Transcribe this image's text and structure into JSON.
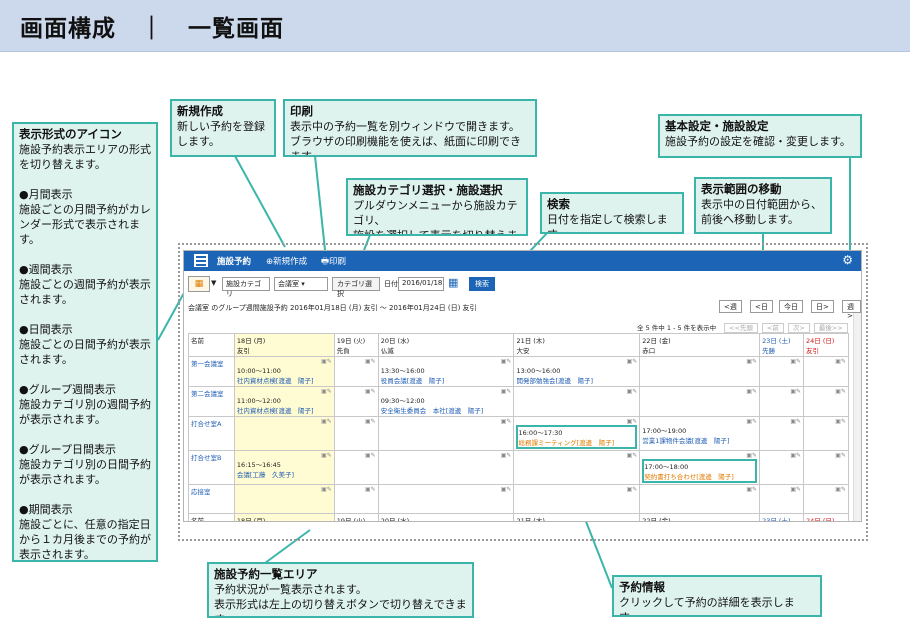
{
  "header": {
    "title": "画面構成　｜　一覧画面"
  },
  "callouts": {
    "view_icons": {
      "title": "表示形式のアイコン",
      "body": "施設予約表示エリアの形式\nを切り替えます。\n\n●月間表示\n施設ごとの月間予約がカレ\nンダー形式で表示されます。\n\n●週間表示\n施設ごとの週間予約が表示\nされます。\n\n●日間表示\n施設ごとの日間予約が表示\nされます。\n\n●グループ週間表示\n施設カテゴリ別の週間予約\nが表示されます。\n\n●グループ日間表示\n施設カテゴリ別の日間予約\nが表示されます。\n\n●期間表示\n施設ごとに、任意の指定日\nから１カ月後までの予約が\n表示されます。"
    },
    "new": {
      "title": "新規作成",
      "body": "新しい予約を登録\nします。"
    },
    "print": {
      "title": "印刷",
      "body": "表示中の予約一覧を別ウィンドウで開きます。\nブラウザの印刷機能を使えば、紙面に印刷できます。"
    },
    "settings": {
      "title": "基本設定・施設設定",
      "body": "施設予約の設定を確認・変更します。"
    },
    "category": {
      "title": "施設カテゴリ選択・施設選択",
      "body": "プルダウンメニューから施設カテゴリ、\n施設を選択して表示を切り替えます。"
    },
    "search": {
      "title": "検索",
      "body": "日付を指定して検索します。"
    },
    "range": {
      "title": "表示範囲の移動",
      "body": "表示中の日付範囲から、\n前後へ移動します。"
    },
    "list_area": {
      "title": "施設予約一覧エリア",
      "body": "予約状況が一覧表示されます。\n表示形式は左上の切り替えボタンで切り替えできます。"
    },
    "reservation": {
      "title": "予約情報",
      "body": "クリックして予約の詳細を表示します。"
    }
  },
  "app": {
    "bar_title": "施設予約",
    "new_label": "⊕新規作成",
    "print_label": "印刷",
    "toolbar": {
      "category_label": "施設カテゴリ",
      "category_value": "会議室",
      "facility_button": "カテゴリ選択",
      "date_label": "日付",
      "date_value": "2016/01/18",
      "search_button": "検索"
    },
    "caption": "会議室 のグループ週間施設予約  2016年01月18日 (月) 友引 〜 2016年01月24日 (日) 友引",
    "nav": [
      "<週",
      "<日",
      "今日",
      "日>",
      "週>"
    ],
    "count": "全 5 件中 1 - 5 件を表示中",
    "pager": [
      "<<先頭",
      "<前",
      "次>",
      "最後>>"
    ],
    "table": {
      "name_header": "名前",
      "days": [
        {
          "date": "18日 (月)",
          "rokuyo": "友引",
          "cls": "today"
        },
        {
          "date": "19日 (火)",
          "rokuyo": "先負",
          "cls": ""
        },
        {
          "date": "20日 (水)",
          "rokuyo": "仏滅",
          "cls": ""
        },
        {
          "date": "21日 (木)",
          "rokuyo": "大安",
          "cls": ""
        },
        {
          "date": "22日 (金)",
          "rokuyo": "赤口",
          "cls": ""
        },
        {
          "date": "23日 (土)",
          "rokuyo": "先勝",
          "cls": "sat"
        },
        {
          "date": "24日 (日)",
          "rokuyo": "友引",
          "cls": "sun"
        }
      ],
      "rooms": [
        {
          "name": "第一会議室",
          "events": [
            {
              "time": "10:00〜11:00",
              "title": "社内資材点検[渡邊　陽子]"
            },
            null,
            {
              "time": "13:30〜16:00",
              "title": "役員会議[渡邊　陽子]"
            },
            {
              "time": "13:00〜16:00",
              "title": "開発部勉強会[渡邊　陽子]"
            },
            null,
            null,
            null
          ]
        },
        {
          "name": "第二会議室",
          "events": [
            {
              "time": "11:00〜12:00",
              "title": "社内資材点検[渡邊　陽子]"
            },
            null,
            {
              "time": "09:30〜12:00",
              "title": "安全衛生委員会　本社[渡邊　陽子]"
            },
            null,
            null,
            null,
            null
          ]
        },
        {
          "name": "打合せ室A",
          "events": [
            null,
            null,
            null,
            {
              "time": "16:00〜17:30",
              "title": "総務課ミーティング[渡邊　陽子]",
              "orange": true
            },
            {
              "time": "17:00〜19:00",
              "title": "営業1課物件会議[渡邊　陽子]"
            },
            null,
            null
          ]
        },
        {
          "name": "打合せ室B",
          "events": [
            {
              "time": "16:15〜16:45",
              "title": "会議[工藤　久美子]"
            },
            null,
            null,
            null,
            {
              "time": "17:00〜18:00",
              "title": "契約書打ち合わせ[渡邊　陽子]",
              "orange": true
            },
            null,
            null
          ]
        },
        {
          "name": "応接室",
          "events": [
            null,
            null,
            null,
            null,
            null,
            null,
            null
          ]
        }
      ]
    }
  }
}
